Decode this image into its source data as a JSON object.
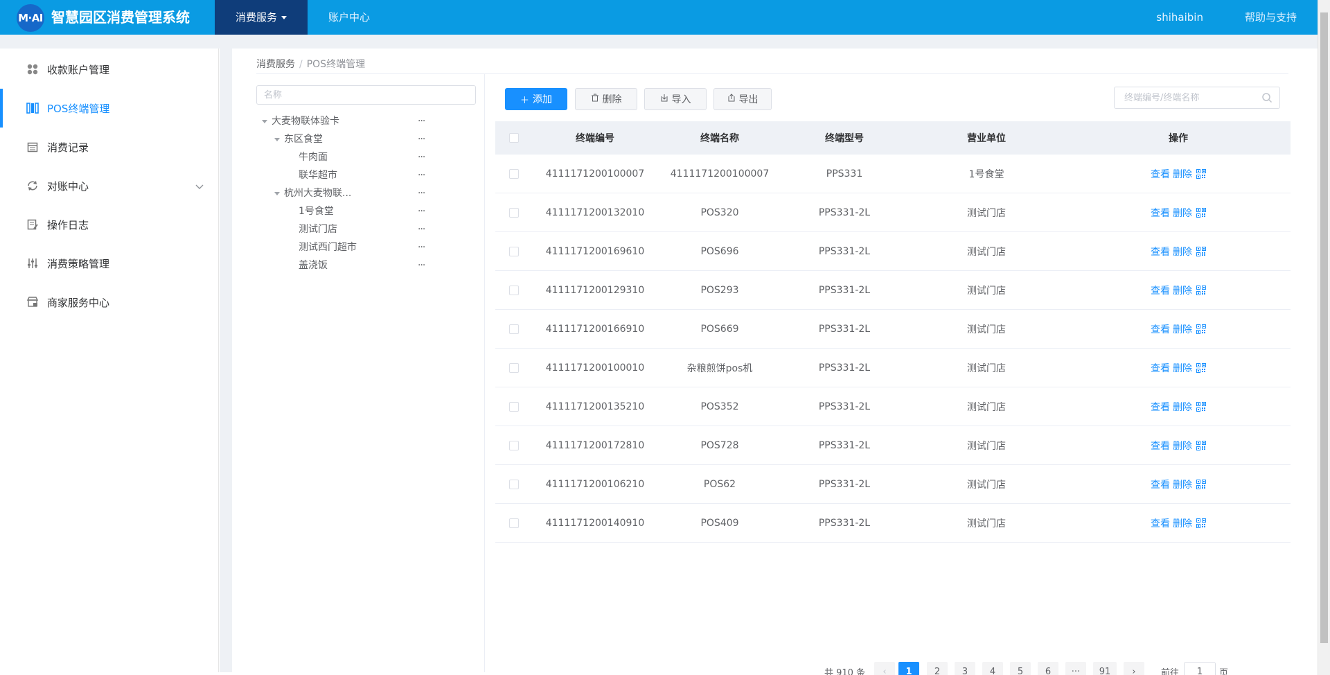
{
  "header": {
    "logo_text": "M·AI",
    "title": "智慧园区消费管理系统",
    "nav": [
      {
        "label": "消费服务"
      },
      {
        "label": "账户中心"
      }
    ],
    "user": "shihaibin",
    "help": "帮助与支持",
    "colors": {
      "bar": "#0a9be3",
      "active": "#0f3d7a"
    }
  },
  "sidebar": {
    "items": [
      {
        "label": "收款账户管理",
        "icon": "grid-icon"
      },
      {
        "label": "POS终端管理",
        "icon": "pos-icon"
      },
      {
        "label": "消费记录",
        "icon": "calendar-icon"
      },
      {
        "label": "对账中心",
        "icon": "reconcile-icon"
      },
      {
        "label": "操作日志",
        "icon": "log-icon"
      },
      {
        "label": "消费策略管理",
        "icon": "sliders-icon"
      },
      {
        "label": "商家服务中心",
        "icon": "shop-icon"
      }
    ]
  },
  "breadcrumb": {
    "root": "消费服务",
    "sep": "/",
    "current": "POS终端管理"
  },
  "tree": {
    "search_placeholder": "名称",
    "more": "···",
    "nodes": [
      {
        "label": "大麦物联体验卡"
      },
      {
        "label": "东区食堂"
      },
      {
        "label": "牛肉面"
      },
      {
        "label": "联华超市"
      },
      {
        "label": "杭州大麦物联..."
      },
      {
        "label": "1号食堂"
      },
      {
        "label": "测试门店"
      },
      {
        "label": "测试西门超市"
      },
      {
        "label": "盖浇饭"
      }
    ]
  },
  "toolbar": {
    "add": "添加",
    "delete": "删除",
    "import": "导入",
    "export": "导出",
    "search_placeholder": "终端编号/终端名称"
  },
  "table": {
    "headers": [
      "终端编号",
      "终端名称",
      "终端型号",
      "营业单位",
      "操作"
    ],
    "view": "查看",
    "remove": "删除",
    "rows": [
      {
        "id": "4111171200100007",
        "name": "4111171200100007",
        "model": "PPS331",
        "unit": "1号食堂"
      },
      {
        "id": "4111171200132010",
        "name": "POS320",
        "model": "PPS331-2L",
        "unit": "测试门店"
      },
      {
        "id": "4111171200169610",
        "name": "POS696",
        "model": "PPS331-2L",
        "unit": "测试门店"
      },
      {
        "id": "4111171200129310",
        "name": "POS293",
        "model": "PPS331-2L",
        "unit": "测试门店"
      },
      {
        "id": "4111171200166910",
        "name": "POS669",
        "model": "PPS331-2L",
        "unit": "测试门店"
      },
      {
        "id": "4111171200100010",
        "name": "杂粮煎饼pos机",
        "model": "PPS331-2L",
        "unit": "测试门店"
      },
      {
        "id": "4111171200135210",
        "name": "POS352",
        "model": "PPS331-2L",
        "unit": "测试门店"
      },
      {
        "id": "4111171200172810",
        "name": "POS728",
        "model": "PPS331-2L",
        "unit": "测试门店"
      },
      {
        "id": "4111171200106210",
        "name": "POS62",
        "model": "PPS331-2L",
        "unit": "测试门店"
      },
      {
        "id": "4111171200140910",
        "name": "POS409",
        "model": "PPS331-2L",
        "unit": "测试门店"
      }
    ]
  },
  "pagination": {
    "total": "共 910 条",
    "prev": "‹",
    "next": "›",
    "pages": [
      "1",
      "2",
      "3",
      "4",
      "5",
      "6",
      "···",
      "91"
    ],
    "current": "1",
    "goto_prefix": "前往",
    "goto_value": "1",
    "goto_suffix": "页"
  }
}
